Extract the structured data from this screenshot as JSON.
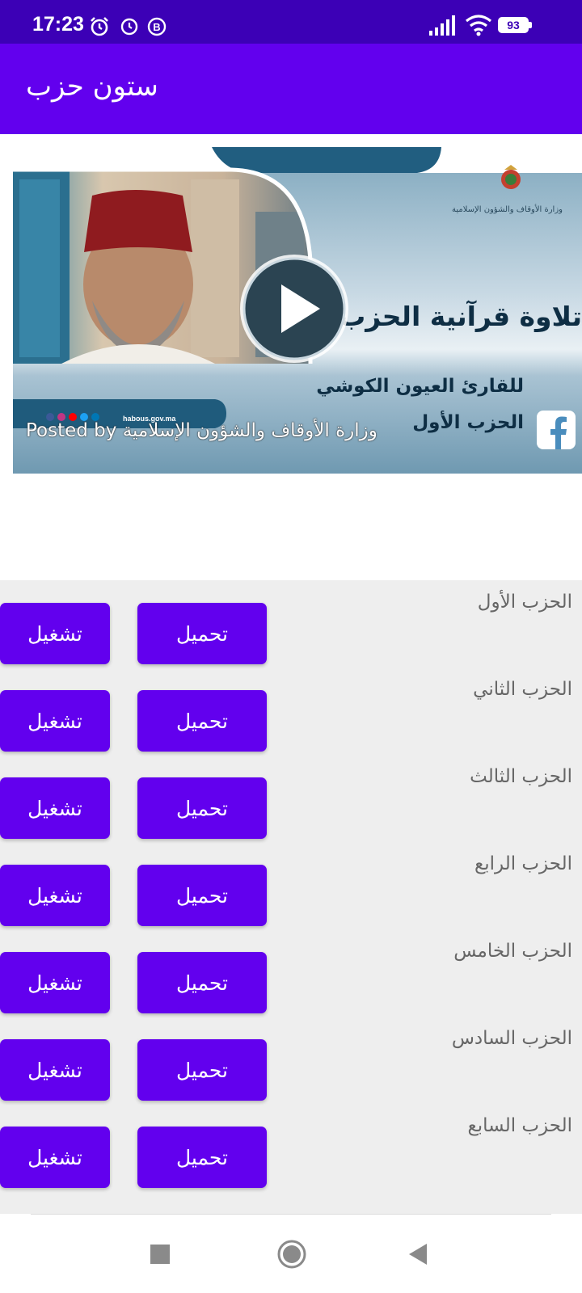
{
  "status_bar": {
    "time": "17:23",
    "battery": "93",
    "icons": [
      "alarm-icon",
      "clock-icon",
      "b-notification-icon",
      "signal-icon",
      "wifi-icon",
      "battery-icon"
    ]
  },
  "app_bar": {
    "title": "ستون حزب"
  },
  "video": {
    "title": "تلاوة قرآنية الحزب",
    "reader": "للقارئ العيون الكوشي",
    "hizb": "الحزب الأول",
    "ministry_small": "وزارة الأوقاف والشؤون الإسلامية",
    "website": "habous.gov.ma",
    "posted_by": "Posted by وزارة الأوقاف والشؤون الإسلامية"
  },
  "items": [
    {
      "label": "الحزب الأول",
      "download": "تحميل",
      "play": "تشغيل"
    },
    {
      "label": "الحزب الثاني",
      "download": "تحميل",
      "play": "تشغيل"
    },
    {
      "label": "الحزب الثالث",
      "download": "تحميل",
      "play": "تشغيل"
    },
    {
      "label": "الحزب الرابع",
      "download": "تحميل",
      "play": "تشغيل"
    },
    {
      "label": "الحزب الخامس",
      "download": "تحميل",
      "play": "تشغيل"
    },
    {
      "label": "الحزب السادس",
      "download": "تحميل",
      "play": "تشغيل"
    },
    {
      "label": "الحزب السابع",
      "download": "تحميل",
      "play": "تشغيل"
    }
  ],
  "colors": {
    "status_bar": "#3c00b6",
    "primary": "#6200ee",
    "list_background": "#eeeeee"
  },
  "nav_bar": {
    "buttons": [
      "recents-square-icon",
      "home-circle-icon",
      "back-triangle-icon"
    ]
  }
}
